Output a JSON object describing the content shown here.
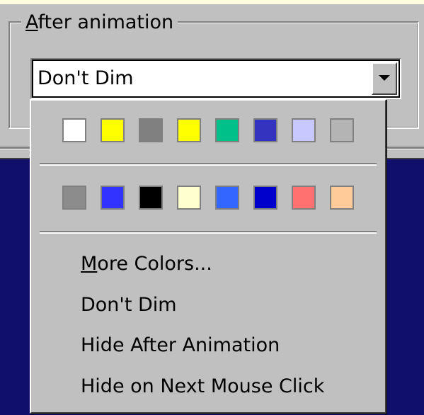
{
  "groupbox": {
    "title": "After animation"
  },
  "combo": {
    "value": "Don't Dim",
    "dropdown_icon": "chevron-down-icon"
  },
  "palette": {
    "row1": [
      {
        "name": "white",
        "color": "#ffffff"
      },
      {
        "name": "yellow",
        "color": "#ffff00"
      },
      {
        "name": "gray",
        "color": "#808080"
      },
      {
        "name": "yellow",
        "color": "#ffff00"
      },
      {
        "name": "teal",
        "color": "#00c08a"
      },
      {
        "name": "blue",
        "color": "#3333c0"
      },
      {
        "name": "lavender",
        "color": "#c8c8ff"
      },
      {
        "name": "silver",
        "color": "#b4b4b4"
      }
    ],
    "row2": [
      {
        "name": "gray",
        "color": "#8c8c8c"
      },
      {
        "name": "blue",
        "color": "#3333ff"
      },
      {
        "name": "black",
        "color": "#000000"
      },
      {
        "name": "light-yellow",
        "color": "#ffffd0"
      },
      {
        "name": "bright-blue",
        "color": "#3366ff"
      },
      {
        "name": "navy",
        "color": "#0000cc"
      },
      {
        "name": "salmon",
        "color": "#ff7070"
      },
      {
        "name": "peach",
        "color": "#ffcc99"
      }
    ]
  },
  "menu": {
    "more_colors": "More Colors...",
    "dont_dim": "Don't Dim",
    "hide_after": "Hide After Animation",
    "hide_next": "Hide on Next Mouse Click"
  }
}
